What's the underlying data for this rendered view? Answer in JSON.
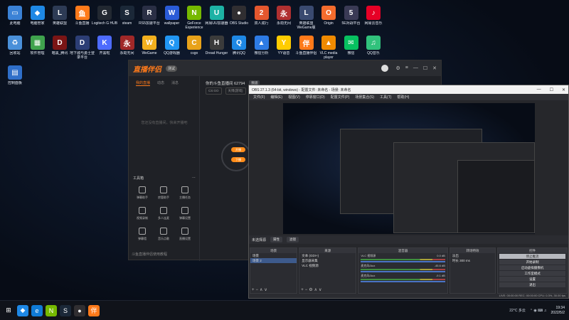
{
  "desktop": {
    "icons": [
      {
        "label": "此电脑",
        "icon": "computer-icon",
        "color": "#3b82d6",
        "glyph": "▭"
      },
      {
        "label": "电脑管家",
        "icon": "pcmanager-icon",
        "color": "#1e88e5",
        "glyph": "◆"
      },
      {
        "label": "英雄联盟",
        "icon": "lol-icon",
        "color": "#2d3b55",
        "glyph": "L"
      },
      {
        "label": "斗鱼直播",
        "icon": "douyu-icon",
        "color": "#ff7a1a",
        "glyph": "鱼"
      },
      {
        "label": "Logitech G HUB",
        "icon": "logitech-icon",
        "color": "#222831",
        "glyph": "G"
      },
      {
        "label": "steam",
        "icon": "steam-icon",
        "color": "#1b2838",
        "glyph": "S"
      },
      {
        "label": "RS5加速平台",
        "icon": "rs5-icon",
        "color": "#2a2f45",
        "glyph": "R"
      },
      {
        "label": "wallpaper",
        "icon": "wallpaper-icon",
        "color": "#2a5bd7",
        "glyph": "W"
      },
      {
        "label": "GeForce Experience",
        "icon": "geforce-icon",
        "color": "#76b900",
        "glyph": "N"
      },
      {
        "label": "网易UU加速器",
        "icon": "uu-icon",
        "color": "#1db2a5",
        "glyph": "U"
      },
      {
        "label": "OBS Studio",
        "icon": "obs-icon",
        "color": "#302e31",
        "glyph": "●"
      },
      {
        "label": "双人成行",
        "icon": "ittakestwo-icon",
        "color": "#e4572e",
        "glyph": "2"
      },
      {
        "label": "永劫无间",
        "icon": "naraka-icon",
        "color": "#b03030",
        "glyph": "永"
      },
      {
        "label": "英雄联盟WeGame版",
        "icon": "lol-wegame-icon",
        "color": "#3a4a70",
        "glyph": "L"
      },
      {
        "label": "Origin",
        "icon": "origin-icon",
        "color": "#f56c2d",
        "glyph": "O"
      },
      {
        "label": "5E对战平台",
        "icon": "5e-icon",
        "color": "#3a3a55",
        "glyph": "5"
      },
      {
        "label": "网易云音乐",
        "icon": "netease-music-icon",
        "color": "#e60026",
        "glyph": "♪"
      },
      {
        "label": "回收站",
        "icon": "recycle-bin-icon",
        "color": "#4a90d9",
        "glyph": "♻"
      },
      {
        "label": "软件管理",
        "icon": "software-manager-icon",
        "color": "#3fa34d",
        "glyph": "▦"
      },
      {
        "label": "暗黑_腾讯",
        "icon": "diablo-icon",
        "color": "#7a1515",
        "glyph": "D"
      },
      {
        "label": "地下城与勇士登录平台",
        "icon": "dnf-icon",
        "color": "#2c3e75",
        "glyph": "D"
      },
      {
        "label": "开黑啦",
        "icon": "kaiheila-icon",
        "color": "#4d6bfe",
        "glyph": "K"
      },
      {
        "label": "永劫无间",
        "icon": "naraka2-icon",
        "color": "#a02828",
        "glyph": "永"
      },
      {
        "label": "WeGame",
        "icon": "wegame-icon",
        "color": "#f2b01e",
        "glyph": "W"
      },
      {
        "label": "QQ游戏器",
        "icon": "qqgame-icon",
        "color": "#2196f3",
        "glyph": "Q"
      },
      {
        "label": "csgo",
        "icon": "csgo-icon",
        "color": "#e8a21a",
        "glyph": "C"
      },
      {
        "label": "Dread Hunger",
        "icon": "dreadhunger-icon",
        "color": "#3b3b3b",
        "glyph": "H"
      },
      {
        "label": "腾讯QQ",
        "icon": "qq-icon",
        "color": "#1e88e5",
        "glyph": "Q"
      },
      {
        "label": "微信分析",
        "icon": "analysis-icon",
        "color": "#2d7be5",
        "glyph": "▲"
      },
      {
        "label": "YY语音",
        "icon": "yy-icon",
        "color": "#ffcc00",
        "glyph": "Y"
      },
      {
        "label": "斗鱼直播伴侣",
        "icon": "douyu-companion-icon",
        "color": "#ff7a1a",
        "glyph": "伴"
      },
      {
        "label": "VLC media player",
        "icon": "vlc-icon",
        "color": "#f08a00",
        "glyph": "▲"
      },
      {
        "label": "微信",
        "icon": "wechat-icon",
        "color": "#07c160",
        "glyph": "✉"
      },
      {
        "label": "QQ音乐",
        "icon": "qqmusic-icon",
        "color": "#31c27c",
        "glyph": "♫"
      },
      {
        "label": "控制面板",
        "icon": "control-panel-icon",
        "color": "#2f6fc9",
        "glyph": "▤"
      }
    ]
  },
  "douyu": {
    "logo": "直播伴侣",
    "version": "测试",
    "tabs": [
      "我的直播",
      "动态",
      "消息"
    ],
    "empty_text": "您还没有直播间，快来开播吧",
    "room_title": "你的斗鱼直播间 62794",
    "room_tag": "频道",
    "sub_tags": [
      "CS:GO",
      "天博(游戏)"
    ],
    "tools_header": "工具箱",
    "tools": [
      "弹幕助手",
      "房管助手",
      "主播任务",
      "视频录制",
      "多人连麦",
      "弹幕设置",
      "弹幕墙",
      "音乐点歌",
      "直播设置"
    ],
    "pills": [
      "开播",
      "下播"
    ],
    "footer": "斗鱼直播伴侣使用教程"
  },
  "obs": {
    "title": "OBS 27.1.3 (64-bit, windows) - 配置文件: 未命名 - 场景: 未命名",
    "menu": [
      "文件(F)",
      "编辑(E)",
      "视图(V)",
      "停靠窗口(D)",
      "配置文件(P)",
      "场景集合(S)",
      "工具(T)",
      "帮助(H)"
    ],
    "scene_label": "未选择源",
    "scene_buttons": [
      "属性",
      "滤镜"
    ],
    "docks": {
      "scenes": {
        "title": "场景",
        "items": [
          "场景",
          "场景 2"
        ]
      },
      "sources": {
        "title": "来源",
        "items": [
          "文本 (GDI+)",
          "显示器采集",
          "VLC 视频源"
        ]
      },
      "mixer": {
        "title": "混音器",
        "items": [
          {
            "name": "VLC 视频源",
            "db": "0.0 dB"
          },
          {
            "name": "麦克风/Aux",
            "db": "-45.6 dB"
          },
          {
            "name": "麦克风/Aux",
            "db": "-9.1 dB"
          }
        ]
      },
      "transitions": {
        "title": "转场特效",
        "type": "淡出",
        "duration_label": "时长",
        "duration": "300 ms"
      },
      "controls": {
        "title": "控件",
        "buttons": [
          "停止推流",
          "开始录制",
          "启动虚拟摄像机",
          "工作室模式",
          "设置",
          "退出"
        ]
      }
    },
    "status": "LIVE: 00:00:00  REC: 00:00:00  CPU: 0.3%, 30.00 fps"
  },
  "taskbar": {
    "apps": [
      {
        "icon": "windows-start-icon",
        "glyph": "⊞",
        "color": "#10131a"
      },
      {
        "icon": "pcmanager-icon",
        "glyph": "◆",
        "color": "#1e88e5"
      },
      {
        "icon": "edge-icon",
        "glyph": "e",
        "color": "#0f7bd6"
      },
      {
        "icon": "nvidia-icon",
        "glyph": "N",
        "color": "#76b900"
      },
      {
        "icon": "steam-icon",
        "glyph": "S",
        "color": "#1b2838"
      },
      {
        "icon": "obs-icon",
        "glyph": "●",
        "color": "#302e31"
      },
      {
        "icon": "douyu-companion-icon",
        "glyph": "伴",
        "color": "#ff7a1a"
      }
    ],
    "weather": "22°C 多云",
    "time": "19:34",
    "date": "2022/5/2"
  }
}
